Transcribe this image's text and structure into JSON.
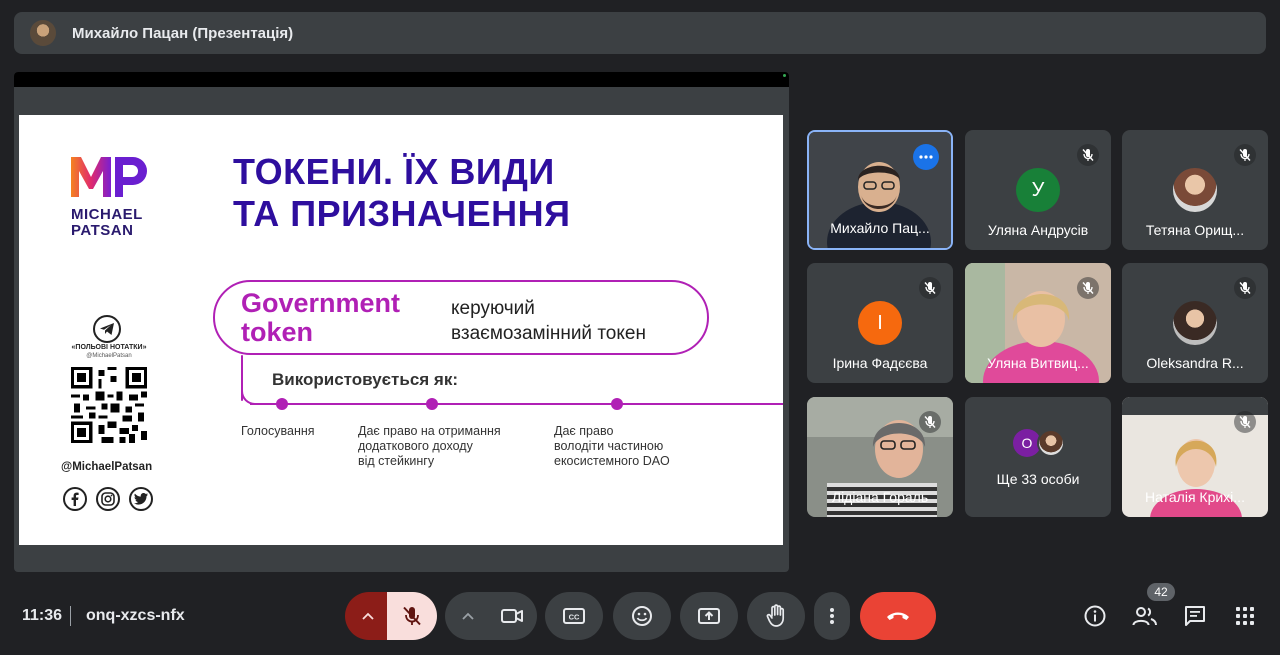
{
  "header": {
    "presenter_title": "Михайло Пацан (Презентація)"
  },
  "slide": {
    "logo_letters": "MP",
    "logo_line1": "MICHAEL",
    "logo_line2": "PATSAN",
    "title_line1": "ТОКЕНИ. ЇХ ВИДИ",
    "title_line2": "ТА ПРИЗНАЧЕННЯ",
    "token_line1": "Government",
    "token_line2": "token",
    "desc_line1": "керуючий",
    "desc_line2": "взаємозамінний токен",
    "used_as": "Використовується як:",
    "uses": [
      {
        "lines": [
          "Голосування"
        ]
      },
      {
        "lines": [
          "Дає право на отримання",
          "додаткового доходу",
          "від стейкингу"
        ]
      },
      {
        "lines": [
          "Дає право",
          "володіти частиною",
          "екосистемного DAO"
        ]
      }
    ],
    "telegram_label": "«ПОЛЬОВІ НОТАТКИ»",
    "telegram_handle": "@MichaelPatsan",
    "social_handle": "@MichaelPatsan",
    "social_icons": [
      "f",
      "ig",
      "tw"
    ]
  },
  "participants": [
    {
      "name": "Михайло Пац...",
      "type": "video",
      "speaking": true
    },
    {
      "name": "Уляна Андрусів",
      "type": "letter",
      "letter": "У",
      "color": "#188038",
      "muted": true
    },
    {
      "name": "Тетяна Орищ...",
      "type": "photo",
      "muted": true
    },
    {
      "name": "Ірина Фадєєва",
      "type": "letter",
      "letter": "І",
      "color": "#f6690e",
      "muted": true
    },
    {
      "name": "Уляна Витвиц...",
      "type": "video",
      "muted": true
    },
    {
      "name": "Oleksandra R...",
      "type": "photo",
      "muted": true
    },
    {
      "name": "Лідіана Гораль",
      "type": "video",
      "muted": true
    },
    {
      "name": "Ще 33 особи",
      "type": "more",
      "letter": "О"
    },
    {
      "name": "Наталія Крихі...",
      "type": "video",
      "muted": true
    }
  ],
  "bottom": {
    "time": "11:36",
    "meeting_code": "onq-xzcs-nfx",
    "participants_count": "42"
  },
  "colors": {
    "accent": "#b020b5",
    "title": "#2e0e9e",
    "end_call": "#ea4335",
    "mic_muted": "#f9dedc"
  }
}
